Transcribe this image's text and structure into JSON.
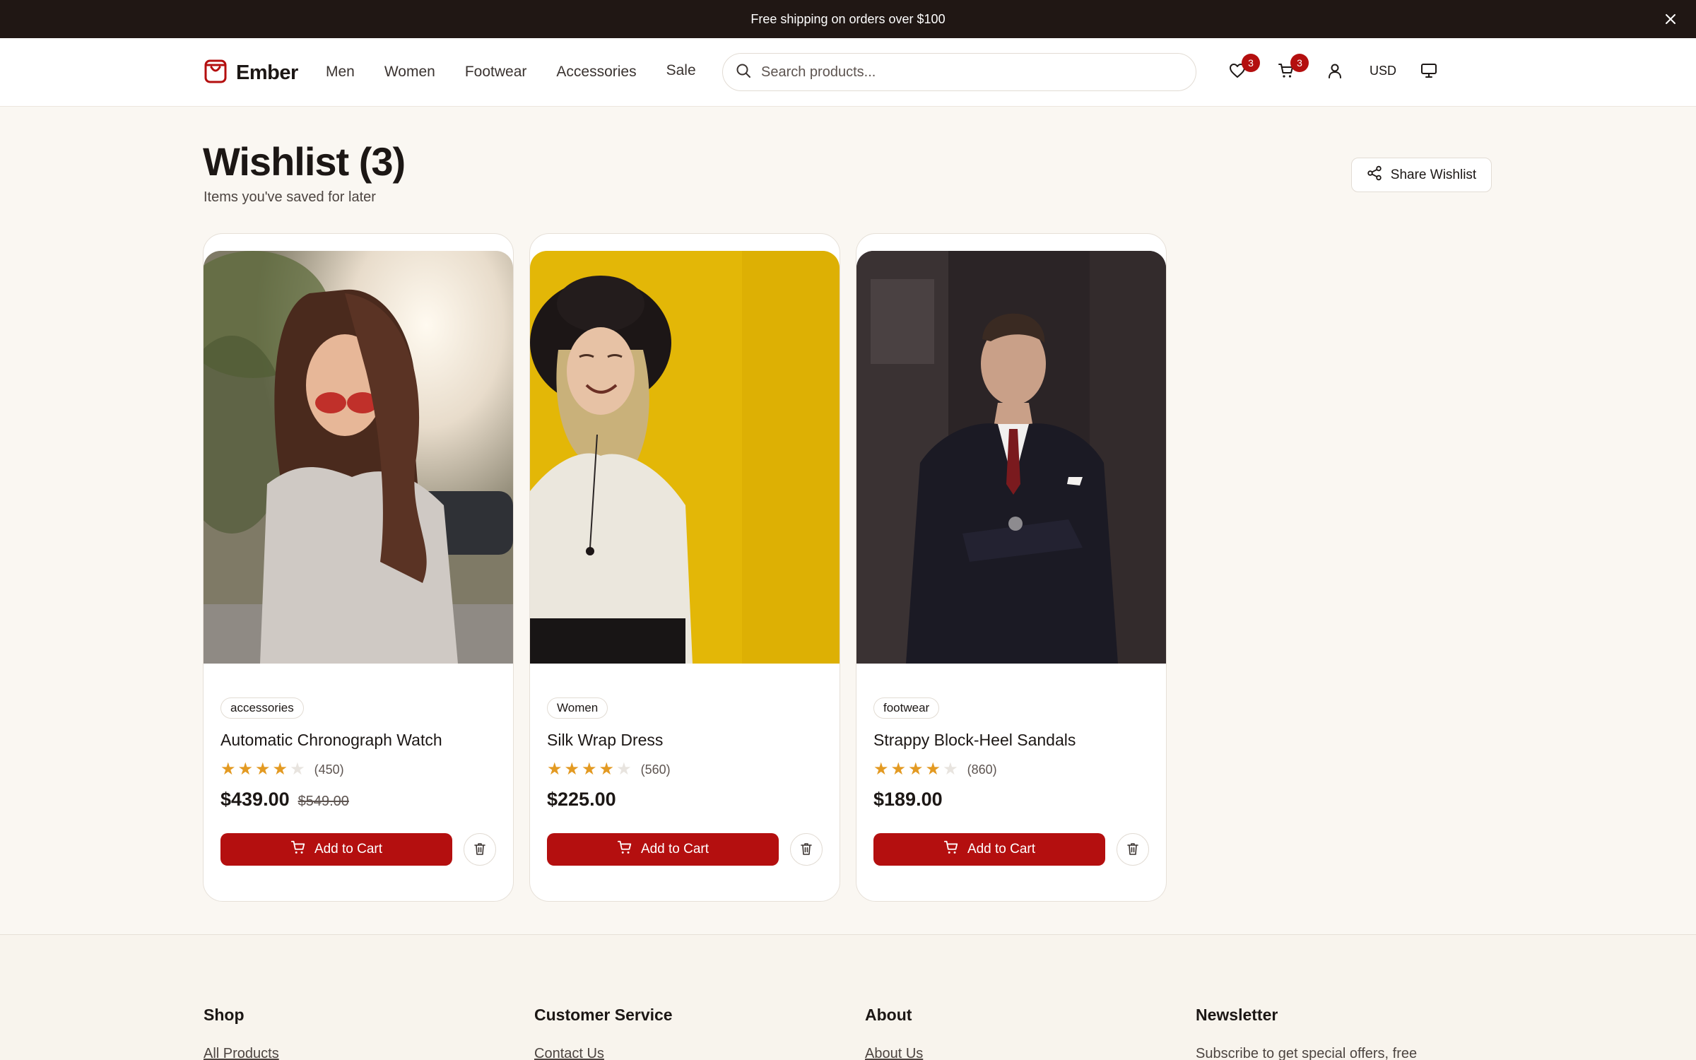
{
  "announcement": {
    "text": "Free shipping on orders over $100",
    "close_icon": "close-icon"
  },
  "header": {
    "brand": "Ember",
    "nav": [
      "Men",
      "Women",
      "Footwear",
      "Accessories",
      "Sale"
    ],
    "search_placeholder": "Search products...",
    "wishlist_count": "3",
    "cart_count": "3",
    "currency": "USD",
    "icons": [
      "shopping-bag-icon",
      "search-icon",
      "heart-icon",
      "cart-icon",
      "user-icon",
      "monitor-icon"
    ]
  },
  "page": {
    "title": "Wishlist (3)",
    "subtitle": "Items you've saved for later",
    "share_label": "Share Wishlist"
  },
  "products": [
    {
      "tag": "accessories",
      "name": "Automatic Chronograph Watch",
      "rating": 4,
      "reviews": "(450)",
      "price": "$439.00",
      "original_price": "$549.00",
      "add_label": "Add to Cart"
    },
    {
      "tag": "Women",
      "name": "Silk Wrap Dress",
      "rating": 4,
      "reviews": "(560)",
      "price": "$225.00",
      "original_price": "",
      "add_label": "Add to Cart"
    },
    {
      "tag": "footwear",
      "name": "Strappy Block-Heel Sandals",
      "rating": 4,
      "reviews": "(860)",
      "price": "$189.00",
      "original_price": "",
      "add_label": "Add to Cart"
    }
  ],
  "footer": {
    "columns": [
      {
        "title": "Shop",
        "first_link": "All Products"
      },
      {
        "title": "Customer Service",
        "first_link": "Contact Us"
      },
      {
        "title": "About",
        "first_link": "About Us"
      },
      {
        "title": "Newsletter",
        "first_link": "Subscribe to get special offers, free"
      }
    ]
  },
  "colors": {
    "accent": "#b40f0f",
    "background": "#faf7f2",
    "announcement_bg": "#201714",
    "star": "#e39a22"
  }
}
